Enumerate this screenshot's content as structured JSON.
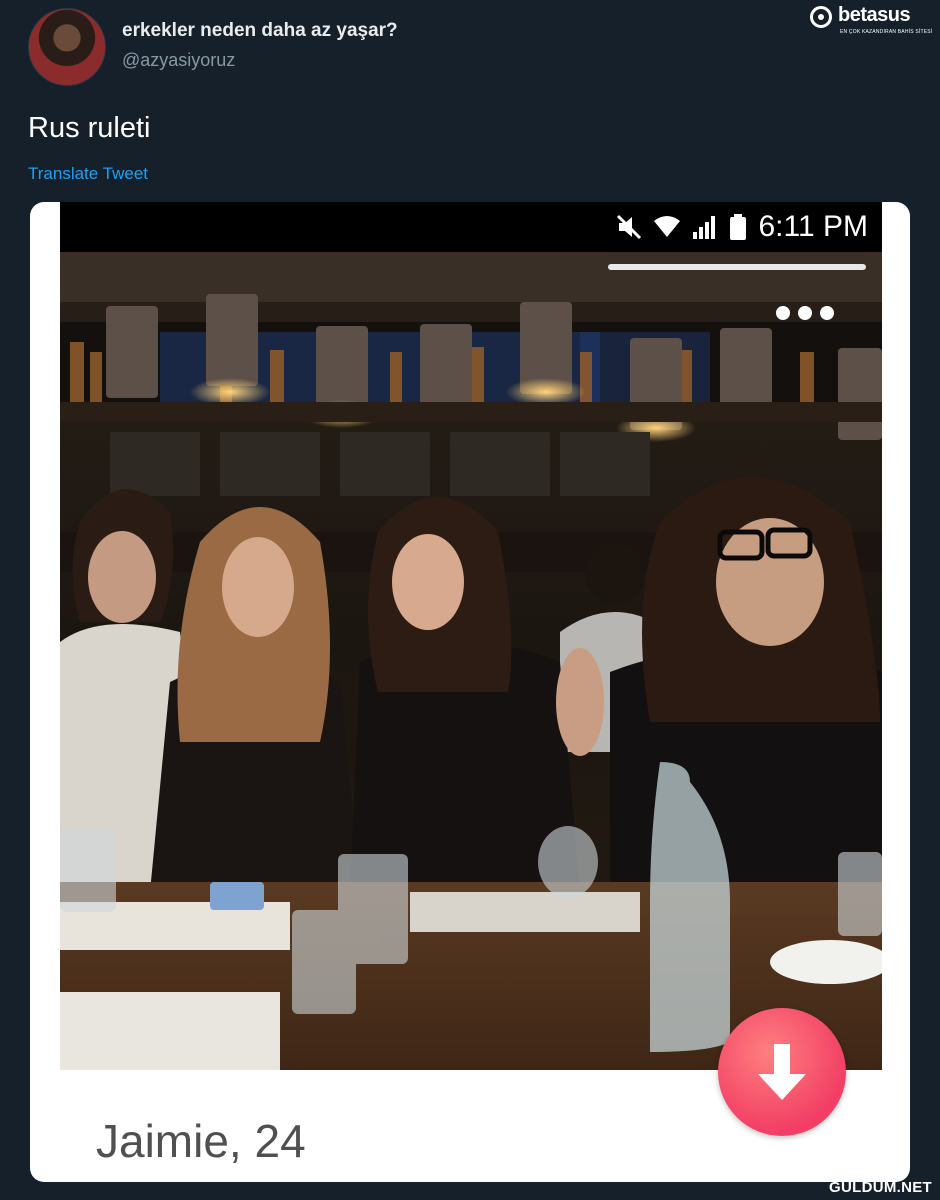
{
  "tweet": {
    "author_name": "erkekler neden daha az yaşar?",
    "author_handle": "@azyasiyoruz",
    "text": "Rus ruleti",
    "translate_label": "Translate Tweet"
  },
  "watermark": {
    "brand": "betasus",
    "tagline": "EN ÇOK KAZANDIRAN BAHİS SİTESİ"
  },
  "phone_screenshot": {
    "status_time": "6:11 PM",
    "status_icons": [
      "mute-icon",
      "wifi-icon",
      "signal-icon",
      "battery-icon"
    ],
    "profile_label": "Jaimie, 24",
    "colors": {
      "dislike_button": "#f23e65"
    }
  },
  "footer": {
    "site": "GULDUM.NET"
  },
  "colors": {
    "background": "#15202b",
    "link": "#1da1f2",
    "handle": "#8899a6"
  }
}
